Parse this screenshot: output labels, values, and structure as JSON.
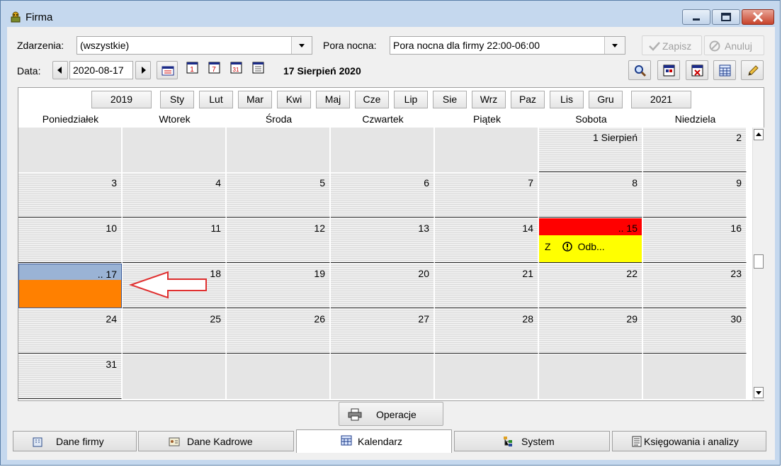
{
  "window": {
    "title": "Firma"
  },
  "toolbar": {
    "zdarzenia_label": "Zdarzenia:",
    "zdarzenia_value": "(wszystkie)",
    "pora_label": "Pora nocna:",
    "pora_value": "Pora nocna dla firmy 22:00-06:00",
    "zapisz_label": "Zapisz",
    "anuluj_label": "Anuluj",
    "data_label": "Data:",
    "date_value": "2020-08-17",
    "date_display": "17 Sierpień 2020"
  },
  "calendar": {
    "prev_year": "2019",
    "next_year": "2021",
    "months": [
      "Sty",
      "Lut",
      "Mar",
      "Kwi",
      "Maj",
      "Cze",
      "Lip",
      "Sie",
      "Wrz",
      "Paz",
      "Lis",
      "Gru"
    ],
    "weekdays": [
      "Poniedziałek",
      "Wtorek",
      "Środa",
      "Czwartek",
      "Piątek",
      "Sobota",
      "Niedziela"
    ],
    "rows": [
      [
        "",
        "",
        "",
        "",
        "",
        "1 Sierpień",
        "2"
      ],
      [
        "3",
        "4",
        "5",
        "6",
        "7",
        "8",
        "9"
      ],
      [
        "10",
        "11",
        "12",
        "13",
        "14",
        ".. 15",
        "16"
      ],
      [
        ".. 17",
        "18",
        "19",
        "20",
        "21",
        "22",
        "23"
      ],
      [
        "24",
        "25",
        "26",
        "27",
        "28",
        "29",
        "30"
      ],
      [
        "31",
        "",
        "",
        "",
        "",
        "",
        ""
      ]
    ],
    "event": {
      "code": "Z",
      "text": "Odb..."
    },
    "colors": {
      "holiday_header": "#ff0000",
      "holiday_body": "#ffff00",
      "selected_header": "#9ab3d5",
      "selected_body": "#ff8000",
      "arrow": "#e03030"
    }
  },
  "operacje_label": "Operacje",
  "tabs": [
    "Dane firmy",
    "Dane Kadrowe",
    "Kalendarz",
    "System",
    "Księgowania i analizy"
  ]
}
